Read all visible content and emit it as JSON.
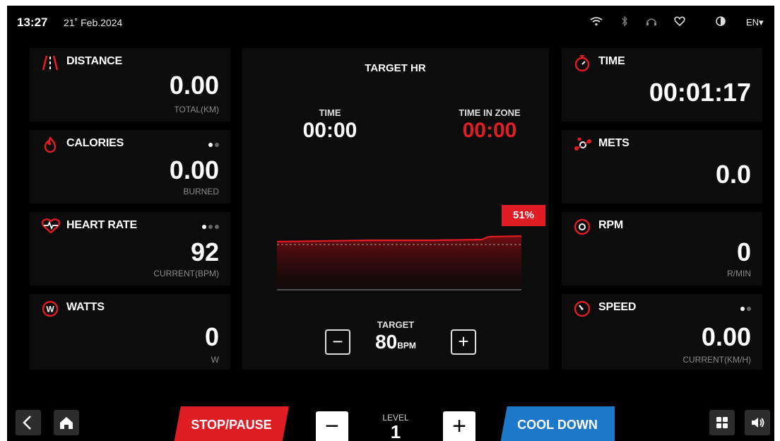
{
  "status": {
    "time": "13:27",
    "date": "21˚ Feb.2024",
    "language": "EN▾",
    "icons": [
      "wifi-icon",
      "bluetooth-icon",
      "headphones-icon",
      "heart-shield-icon",
      "contrast-icon"
    ]
  },
  "left_cards": {
    "distance": {
      "title": "DISTANCE",
      "value": "0.00",
      "unit": "TOTAL(KM)"
    },
    "calories": {
      "title": "CALORIES",
      "value": "0.00",
      "unit": "BURNED"
    },
    "heart_rate": {
      "title": "HEART RATE",
      "value": "92",
      "unit": "CURRENT(BPM)"
    },
    "watts": {
      "title": "WATTS",
      "value": "0",
      "unit": "W"
    }
  },
  "right_cards": {
    "time": {
      "title": "TIME",
      "value": "00:01:17"
    },
    "mets": {
      "title": "METS",
      "value": "0.0"
    },
    "rpm": {
      "title": "RPM",
      "value": "0",
      "unit": "R/MIN"
    },
    "speed": {
      "title": "SPEED",
      "value": "0.00",
      "unit": "CURRENT(KM/H)"
    }
  },
  "center": {
    "title": "TARGET HR",
    "time_label": "TIME",
    "time_value": "00:00",
    "zone_label": "TIME IN ZONE",
    "zone_value": "00:00",
    "percent": "51%",
    "target_label": "TARGET",
    "target_value": "80",
    "target_unit": "BPM",
    "minus": "−",
    "plus": "+"
  },
  "bottom": {
    "stop_label": "STOP/PAUSE",
    "cool_label": "COOL DOWN",
    "level_label": "LEVEL",
    "level_value": "1",
    "minus": "−",
    "plus": "+"
  },
  "colors": {
    "accent_red": "#e01c24",
    "accent_blue": "#1d78c9",
    "panel_bg": "#0c0c0c"
  }
}
